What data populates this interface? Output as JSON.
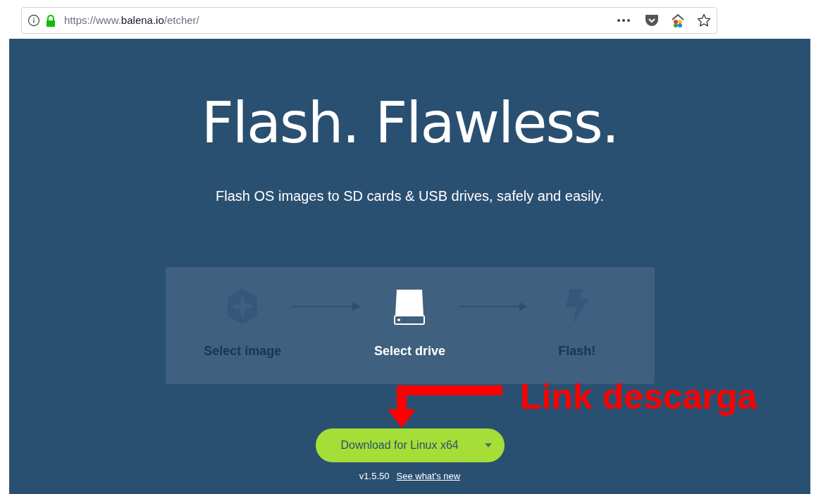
{
  "address_bar": {
    "scheme": "https://www.",
    "host": "balena.io",
    "path": "/etcher/"
  },
  "hero": {
    "title": "Flash. Flawless.",
    "subtitle": "Flash OS images to SD cards & USB drives, safely and easily."
  },
  "steps": [
    {
      "kind": "image",
      "label": "Select image",
      "active": false
    },
    {
      "kind": "drive",
      "label": "Select drive",
      "active": true
    },
    {
      "kind": "flash",
      "label": "Flash!",
      "active": false
    }
  ],
  "annotation": {
    "text": "Link descarga"
  },
  "download": {
    "label": "Download for Linux x64",
    "version": "v1.5.50",
    "link": "See what's new"
  }
}
